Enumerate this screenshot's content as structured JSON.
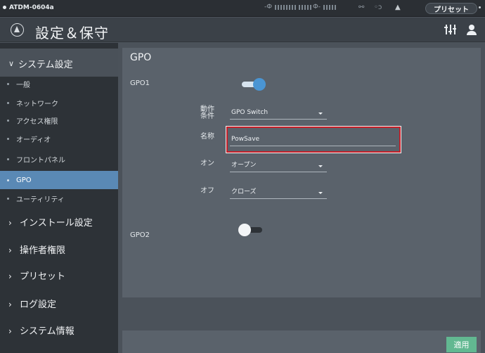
{
  "status_bar": {
    "device": "ATDM-0604a",
    "preset_label": "プリセット"
  },
  "header": {
    "title": "設定＆保守"
  },
  "sidebar": {
    "expanded_section": "システム設定",
    "sub_items": [
      {
        "label": "一般"
      },
      {
        "label": "ネットワーク"
      },
      {
        "label": "アクセス権限"
      },
      {
        "label": "オーディオ"
      },
      {
        "label": "フロントパネル"
      },
      {
        "label": "GPO",
        "active": true
      },
      {
        "label": "ユーティリティ"
      }
    ],
    "sections": [
      {
        "label": "インストール設定"
      },
      {
        "label": "操作者権限"
      },
      {
        "label": "プリセット"
      },
      {
        "label": "ログ設定"
      },
      {
        "label": "システム情報"
      }
    ]
  },
  "main": {
    "title": "GPO",
    "gpo1": {
      "label": "GPO1",
      "enabled": true,
      "trigger_label": "動作条件",
      "trigger_value": "GPO Switch",
      "name_label": "名称",
      "name_value": "PowSave",
      "on_label": "オン",
      "on_value": "オープン",
      "off_label": "オフ",
      "off_value": "クローズ"
    },
    "gpo2": {
      "label": "GPO2",
      "enabled": false
    }
  },
  "footer": {
    "apply_label": "適用"
  },
  "colors": {
    "accent": "#5a89b5",
    "apply_button": "#62b891",
    "highlight": "#c6202a"
  }
}
